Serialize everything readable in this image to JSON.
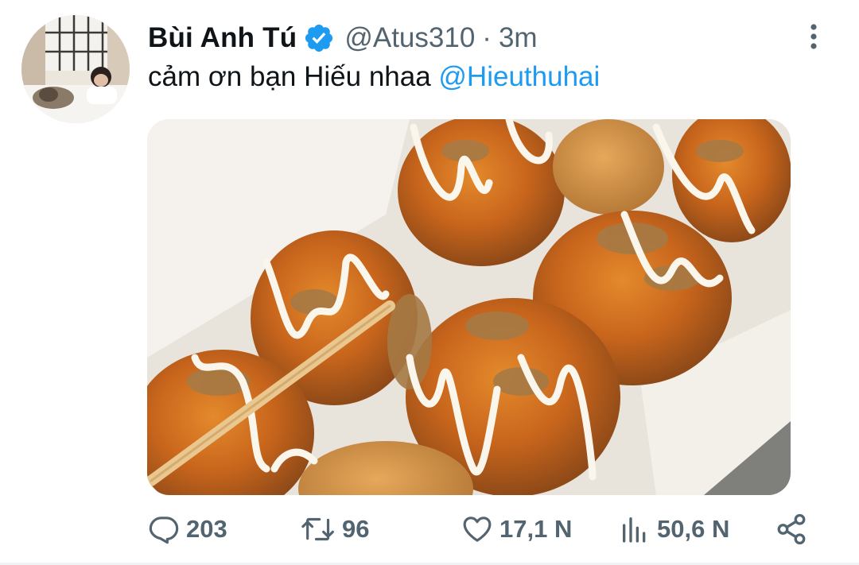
{
  "tweet": {
    "display_name": "Bùi Anh Tú",
    "handle": "@Atus310",
    "separator": "·",
    "time": "3m",
    "text_plain": "cảm ơn bạn Hiếu nhaa ",
    "text_mention": "@Hieuthuhai"
  },
  "actions": {
    "replies": "203",
    "retweets": "96",
    "likes": "17,1 N",
    "views": "50,6 N"
  },
  "icons": {
    "verified": "verified-badge-icon",
    "more": "more-vertical-icon",
    "reply": "reply-icon",
    "retweet": "retweet-icon",
    "like": "heart-icon",
    "views": "analytics-icon",
    "share": "share-icon"
  },
  "colors": {
    "accent": "#1d9bf0",
    "secondary_text": "#536471",
    "primary_text": "#0f1419"
  }
}
